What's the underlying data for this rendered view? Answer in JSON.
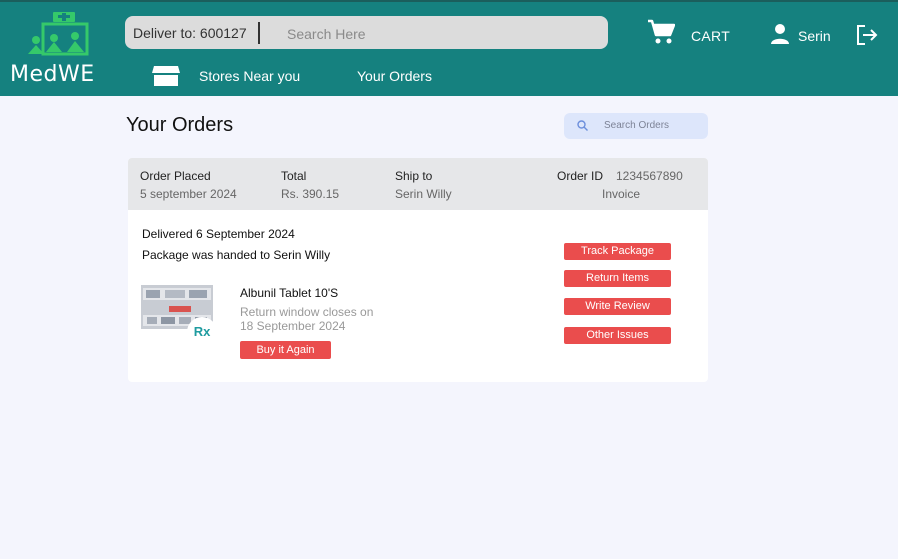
{
  "brand": {
    "name": "MedWE"
  },
  "header": {
    "deliver_to": "Deliver to: 600127",
    "search_placeholder": "Search Here",
    "cart_label": "CART",
    "user_name": "Serin"
  },
  "nav": {
    "stores": "Stores Near you",
    "orders": "Your Orders"
  },
  "orders_page": {
    "title": "Your Orders",
    "search_placeholder": "Search Orders",
    "order": {
      "placed_label": "Order Placed",
      "placed_value": "5 september 2024",
      "total_label": "Total",
      "total_value": "Rs. 390.15",
      "ship_label": "Ship to",
      "ship_value": "Serin Willy",
      "id_label": "Order ID",
      "id_value": "1234567890",
      "invoice": "Invoice",
      "status": "Delivered 6 September 2024",
      "handed": "Package was handed to Serin Willy",
      "item": {
        "name": "Albunil Tablet 10'S",
        "return_text": "Return window closes on 18 September 2024",
        "badge": "Rx",
        "buy_again": "Buy it Again"
      },
      "actions": [
        "Track Package",
        "Return Items",
        "Write Review",
        "Other Issues"
      ]
    }
  },
  "colors": {
    "header": "#15817f",
    "button": "#ea4d4d",
    "logo_green": "#35c96a",
    "background": "#f4f5fd"
  },
  "icons": [
    "medwe-logo",
    "cart-icon",
    "user-icon",
    "logout-icon",
    "store-icon",
    "search-icon"
  ]
}
